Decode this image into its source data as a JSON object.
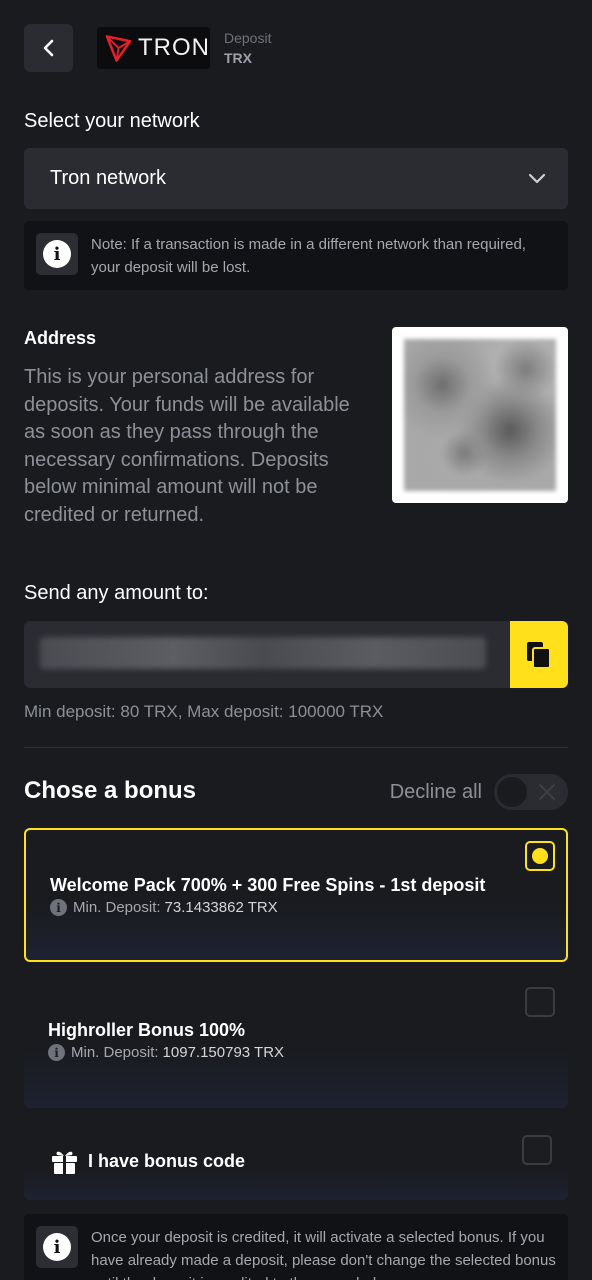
{
  "header": {
    "back_label": "Back",
    "logo_text": "TRON",
    "action": "Deposit",
    "currency": "TRX"
  },
  "network": {
    "title": "Select your network",
    "selected": "Tron network",
    "note": "Note: If a transaction is made in a different network than required, your deposit will be lost."
  },
  "address": {
    "title": "Address",
    "description": "This is your personal address for deposits. Your funds will be available as soon as they pass through the necessary confirmations. Deposits below minimal amount will not be credited or returned.",
    "send_title": "Send any amount to:",
    "limits": "Min deposit: 80 TRX, Max deposit: 100000 TRX"
  },
  "bonus": {
    "title": "Chose a bonus",
    "decline_label": "Decline all",
    "decline_on": false,
    "items": [
      {
        "name": "Welcome Pack 700% + 300 Free Spins - 1st deposit",
        "min_label": "Min. Deposit:",
        "min_value": "73.1433862 TRX",
        "selected": true
      },
      {
        "name": "Highroller Bonus 100%",
        "min_label": "Min. Deposit:",
        "min_value": "1097.150793 TRX",
        "selected": false
      }
    ],
    "code_label": "I have bonus code",
    "note": "Once your deposit is credited, it will activate a selected bonus. If you have already made a deposit, please don't change the selected bonus until the deposit is credited to the game balance."
  },
  "colors": {
    "accent": "#ffe01b",
    "background": "#1a1b1f",
    "surface": "#2a2c32",
    "tron_red": "#e5202a"
  },
  "icons": {
    "back": "chevron-left-icon",
    "dropdown": "chevron-down-icon",
    "info": "info-icon",
    "copy": "copy-icon",
    "gift": "gift-icon"
  }
}
